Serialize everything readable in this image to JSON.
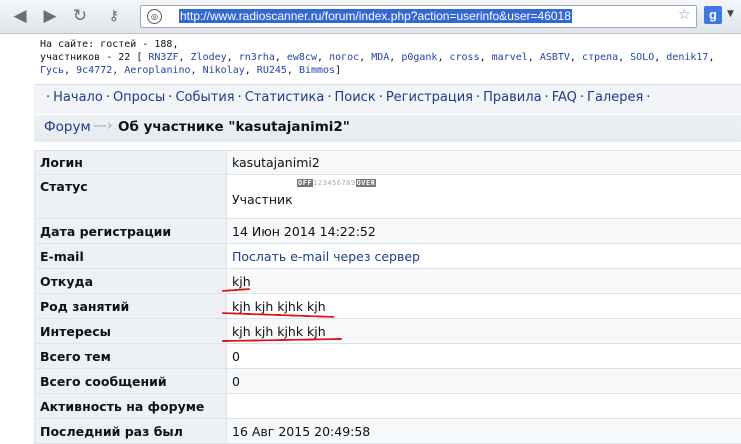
{
  "browser": {
    "url": "http://www.radioscanner.ru/forum/index.php?action=userinfo&user=46018",
    "search_engine": "g"
  },
  "online": {
    "line1": "На сайте: гостей - 188,",
    "prefix": "участников - 22 [",
    "suffix": "]",
    "users": [
      "RN3ZF",
      "Zlodey",
      "rn3rha",
      "ew8cw",
      "логос",
      "MDA",
      "p0gank",
      "cross",
      "marvel",
      "ASBTV",
      "стрела",
      "SOLO",
      "denik17",
      "Гусь",
      "9c4772",
      "Aeroplanino",
      "Nikolay",
      "RU245",
      "Bimmos"
    ]
  },
  "menu": {
    "items": [
      "Начало",
      "Опросы",
      "События",
      "Статистика",
      "Поиск",
      "Регистрация",
      "Правила",
      "FAQ",
      "Галерея"
    ]
  },
  "breadcrumb": {
    "forum": "Форум",
    "arrow": "—›",
    "title": "Об участнике \"kasutajanimi2\""
  },
  "profile": {
    "login": {
      "label": "Логин",
      "value": "kasutajanimi2"
    },
    "status": {
      "label": "Статус",
      "value": "Участник",
      "stars_off": "OFF",
      "stars_digits": "123456789",
      "stars_over": "OVER"
    },
    "reg_date": {
      "label": "Дата регистрации",
      "value": "14 Июн 2014 14:22:52"
    },
    "email": {
      "label": "E-mail",
      "value": "Послать e-mail через сервер"
    },
    "from": {
      "label": "Откуда",
      "value": "kjh"
    },
    "occupation": {
      "label": "Род занятий",
      "value": "kjh kjh kjhk kjh"
    },
    "interests": {
      "label": "Интересы",
      "value": "kjh kjh kjhk kjh"
    },
    "topics": {
      "label": "Всего тем",
      "value": "0"
    },
    "messages": {
      "label": "Всего сообщений",
      "value": "0"
    },
    "activity": {
      "label": "Активность на форуме",
      "value": ""
    },
    "last_seen": {
      "label": "Последний раз был",
      "value": "16 Авг 2015 20:49:58"
    }
  },
  "colors": {
    "annotation": "#dd1111",
    "link": "#1a3d8c"
  }
}
